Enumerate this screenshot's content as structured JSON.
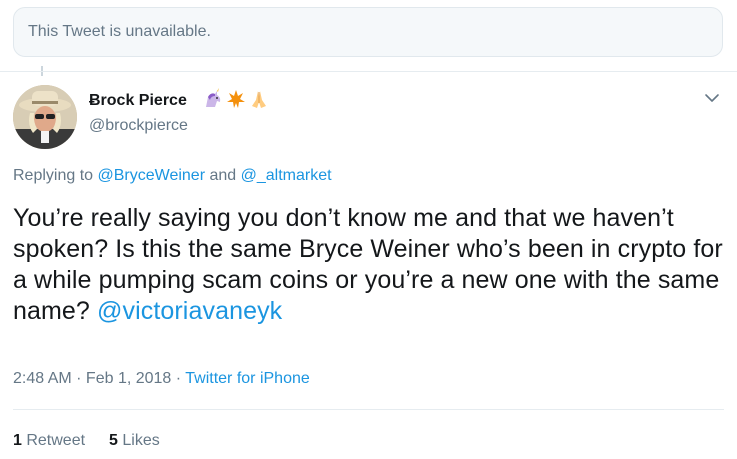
{
  "unavailable_text": "This Tweet is unavailable.",
  "author": {
    "display_name": "Ƀrock Pierce",
    "handle": "@brockpierce",
    "emojis": [
      "unicorn-emoji",
      "rebel-alliance-emoji",
      "folded-hands-emoji"
    ]
  },
  "replying": {
    "prefix": "Replying to ",
    "user1": "@BryceWeiner",
    "joiner": " and ",
    "user2": "@_altmarket"
  },
  "tweet": {
    "text": "You’re really saying you don’t know me and that we haven’t spoken? Is this the same Bryce Weiner who’s been in crypto for a while pumping scam coins or you’re a new one with the same name? ",
    "mention": "@victoriavaneyk"
  },
  "meta": {
    "time": "2:48 AM",
    "sep1": " · ",
    "date": "Feb 1, 2018",
    "sep2": " · ",
    "source": "Twitter for iPhone"
  },
  "stats": {
    "retweets_count": "1",
    "retweets_label": " Retweet",
    "likes_count": "5",
    "likes_label": " Likes"
  },
  "colors": {
    "link": "#1b95e0",
    "secondary_text": "#657786",
    "primary_text": "#14171a"
  }
}
